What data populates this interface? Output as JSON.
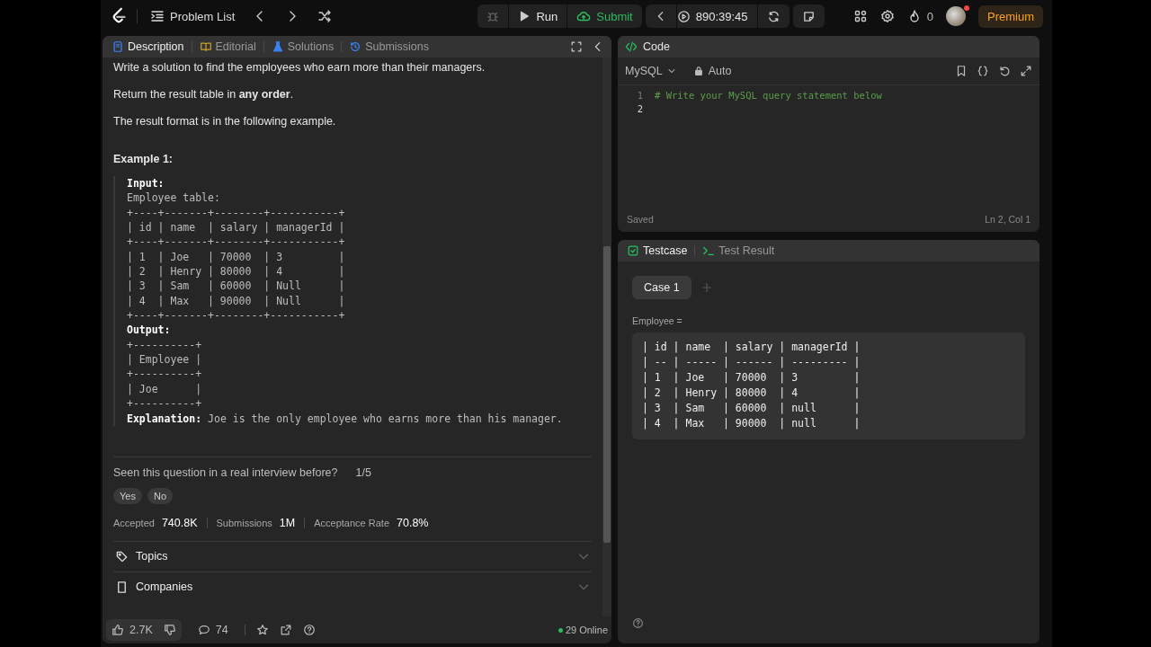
{
  "nav": {
    "problem_list": "Problem List"
  },
  "actions": {
    "run": "Run",
    "submit": "Submit",
    "timer": "890:39:45"
  },
  "account": {
    "streak": "0",
    "premium": "Premium",
    "notification": true
  },
  "description_tabs": [
    {
      "label": "Description",
      "kind": "description",
      "selected": true
    },
    {
      "label": "Editorial",
      "kind": "editorial",
      "selected": false
    },
    {
      "label": "Solutions",
      "kind": "solutions",
      "selected": false
    },
    {
      "label": "Submissions",
      "kind": "submissions",
      "selected": false
    }
  ],
  "description": {
    "paragraphs": [
      "Write a solution to find the employees who earn more than their managers.",
      "Return the result table in **any order**.",
      "The result format is in the following example."
    ]
  },
  "example": {
    "title": "Example 1:",
    "input_label": "Input:",
    "input_caption": "Employee table:",
    "input_table": [
      "+----+-------+--------+-----------+",
      "| id | name  | salary | managerId |",
      "+----+-------+--------+-----------+",
      "| 1  | Joe   | 70000  | 3         |",
      "| 2  | Henry | 80000  | 4         |",
      "| 3  | Sam   | 60000  | Null      |",
      "| 4  | Max   | 90000  | Null      |",
      "+----+-------+--------+-----------+"
    ],
    "output_label": "Output:",
    "output_table": [
      "+----------+",
      "| Employee |",
      "+----------+",
      "| Joe      |",
      "+----------+"
    ],
    "explanation_label": "Explanation:",
    "explanation": "Joe is the only employee who earns more than his manager."
  },
  "interview": {
    "question": "Seen this question in a real interview before?",
    "count": "1/5",
    "answers": [
      "Yes",
      "No"
    ]
  },
  "stats": [
    {
      "label": "Accepted",
      "value": "740.8K"
    },
    {
      "label": "Submissions",
      "value": "1M"
    },
    {
      "label": "Acceptance Rate",
      "value": "70.8%"
    }
  ],
  "sections": [
    {
      "label": "Topics",
      "kind": "topics"
    },
    {
      "label": "Companies",
      "kind": "companies"
    }
  ],
  "footer": {
    "likes": "2.7K",
    "comments": "74",
    "online": "29 Online"
  },
  "code": {
    "title": "Code",
    "language": "MySQL",
    "mode": "Auto",
    "line_numbers": [
      "1",
      "2"
    ],
    "lines": [
      "# Write your MySQL query statement below"
    ],
    "status": "Saved",
    "cursor": "Ln 2, Col 1"
  },
  "testcase_tabs": [
    {
      "label": "Testcase",
      "kind": "testcase",
      "selected": true
    },
    {
      "label": "Test Result",
      "kind": "result",
      "selected": false
    }
  ],
  "cases": [
    {
      "label": "Case 1",
      "selected": true
    }
  ],
  "case_input": {
    "label": "Employee =",
    "table": [
      "| id | name  | salary | managerId |",
      "| -- | ----- | ------ | --------- |",
      "| 1  | Joe   | 70000  | 3         |",
      "| 2  | Henry | 80000  | 4         |",
      "| 3  | Sam   | 60000  | null      |",
      "| 4  | Max   | 90000  | null      |"
    ]
  }
}
